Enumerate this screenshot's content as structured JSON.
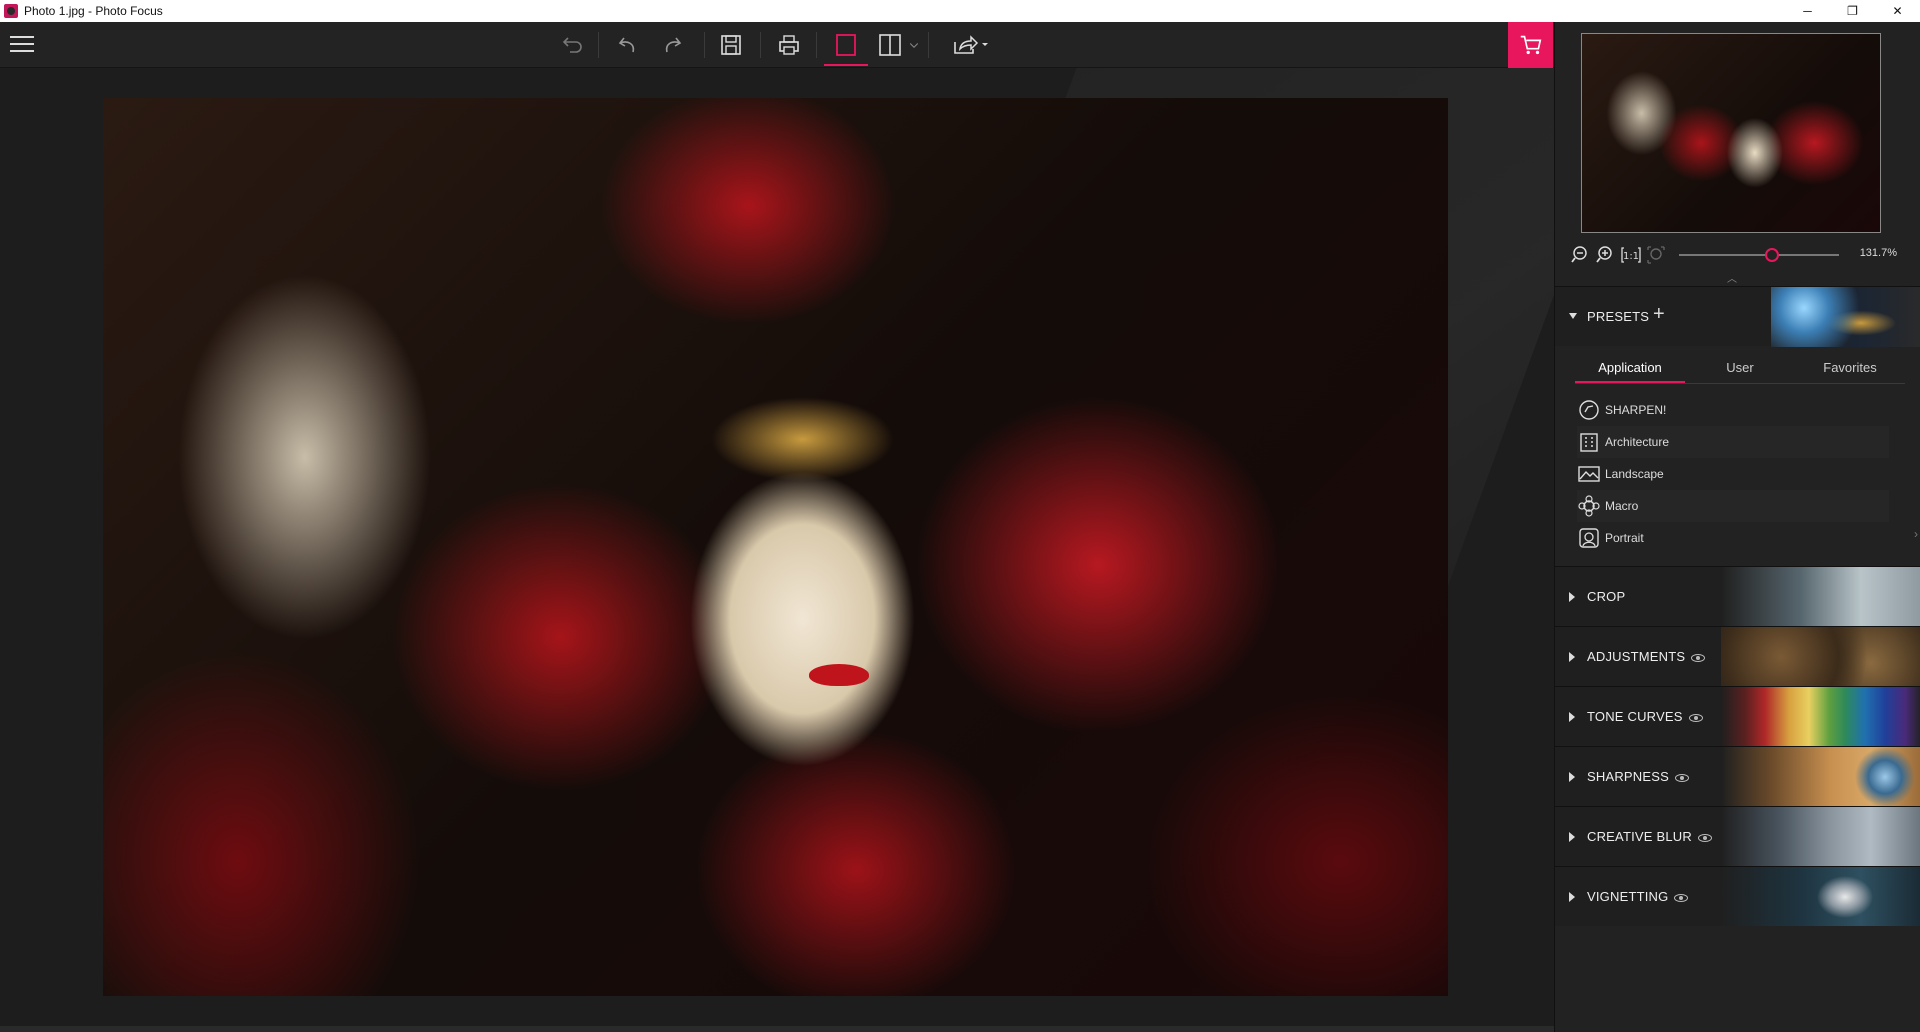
{
  "window": {
    "title": "Photo 1.jpg - Photo Focus",
    "minimize": "─",
    "restore": "❐",
    "close": "✕"
  },
  "navigator": {
    "zoom_value": "131.7%",
    "zoom_fraction": 0.58
  },
  "presets": {
    "title": "PRESETS",
    "add_symbol": "+",
    "tabs": [
      "Application",
      "User",
      "Favorites"
    ],
    "active_tab": "Application",
    "items": [
      "SHARPEN!",
      "Architecture",
      "Landscape",
      "Macro",
      "Portrait"
    ]
  },
  "sections": [
    {
      "label": "CROP",
      "has_eye": false
    },
    {
      "label": "ADJUSTMENTS",
      "has_eye": true
    },
    {
      "label": "TONE CURVES",
      "has_eye": true
    },
    {
      "label": "SHARPNESS",
      "has_eye": true
    },
    {
      "label": "CREATIVE BLUR",
      "has_eye": true
    },
    {
      "label": "VIGNETTING",
      "has_eye": true
    }
  ],
  "colors": {
    "accent": "#e8175d",
    "panel_bg": "#222222",
    "toolbar_bg": "#232323"
  },
  "icons": {
    "menu": "hamburger-menu-icon",
    "undo_all": "undo-all-icon",
    "undo": "undo-icon",
    "redo": "redo-icon",
    "save": "save-icon",
    "print": "print-icon",
    "single_view": "single-view-icon",
    "split_view": "split-view-icon",
    "share": "share-icon",
    "cart": "cart-icon"
  }
}
